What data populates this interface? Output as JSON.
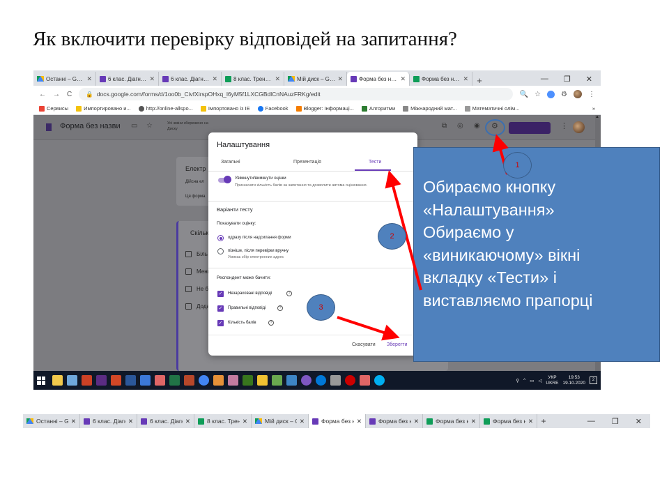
{
  "slide": {
    "title": "Як включити перевірку відповідей на запитання?"
  },
  "browser": {
    "tabs": [
      {
        "label": "Останні – Goog",
        "icon": "drive-icon"
      },
      {
        "label": "6 клас. Діагност",
        "icon": "forms-icon"
      },
      {
        "label": "6 клас. Діагност",
        "icon": "forms-icon"
      },
      {
        "label": "8 клас. Тренува",
        "icon": "sheets-icon"
      },
      {
        "label": "Мій диск – Goo",
        "icon": "drive-icon"
      },
      {
        "label": "Форма без назв",
        "icon": "forms-icon",
        "active": true
      },
      {
        "label": "Форма без назв",
        "icon": "sheets-icon"
      }
    ],
    "url": "docs.google.com/forms/d/1oo0b_CivfXirspOHxq_l6yM5f1LXCGBdlCnNAuzFRKg/edit",
    "bookmarks": [
      "Сервисы",
      "Импортировано и...",
      "http://online-allspo...",
      "Імпортовано із IE",
      "Facebook",
      "Blogger: Інформаці...",
      "Алгоритми",
      "Міжнародний мат...",
      "Математичні олім..."
    ],
    "bookmarks_more": "»"
  },
  "forms_page": {
    "form_name": "Форма без назви",
    "saved_note": "Усі зміни збережено на Диску",
    "bg_heading": "Електр",
    "bg_sub1": "Дійсна ел",
    "bg_sub2": "Ця форма",
    "bg_question": "Скільк",
    "bg_options": [
      "Біль",
      "Менш",
      "Не б",
      "Дода"
    ]
  },
  "dialog": {
    "title": "Налаштування",
    "tabs": [
      "Загальні",
      "Презентація",
      "Тести"
    ],
    "active_tab": "Тести",
    "toggle_label": "Увімкнути/вимкнути оцінки",
    "toggle_desc": "Призначати кількість балів за запитання та дозволити автома оцінювання.",
    "section_title": "Варіанти тесту",
    "show_score_label": "Показувати оцінку:",
    "radio_options": [
      {
        "label": "одразу після надсилання форми",
        "selected": true
      },
      {
        "label": "пізніше, після перевірки вручну",
        "selected": false,
        "sub": "Умикає збір електронних адрес"
      }
    ],
    "respondent_label": "Респондент може бачити:",
    "checkboxes": [
      "Незараховані відповіді",
      "Правильні відповіді",
      "Кількість балів"
    ],
    "cancel_label": "Скасувати",
    "save_label": "Зберегти"
  },
  "taskbar": {
    "lang": "УКР",
    "lang_sub": "UKRE",
    "time": "19:53",
    "date": "19.10.2020",
    "notifications": "2"
  },
  "callout": {
    "lines": [
      "Обираємо кнопку",
      "«Налаштування»",
      "Обираємо у",
      "«виникаючому» вікні",
      "вкладку «Тести» і",
      "виставляємо прапорці"
    ]
  },
  "markers": [
    "1",
    "2",
    "3"
  ],
  "colors": {
    "forms_purple": "#673ab7",
    "callout_blue": "#4f81bd",
    "arrow_red": "#ff0000"
  },
  "bottom_tabbar": {
    "tabs": [
      {
        "label": "Останні – Goog",
        "icon": "drive-icon"
      },
      {
        "label": "6 клас. Діагн",
        "icon": "forms-icon"
      },
      {
        "label": "6 клас. Діагн",
        "icon": "forms-icon"
      },
      {
        "label": "8 клас. Трен",
        "icon": "sheets-icon"
      },
      {
        "label": "Мій диск – G",
        "icon": "drive-icon"
      },
      {
        "label": "Форма без н",
        "icon": "forms-icon",
        "active": true
      },
      {
        "label": "Форма без н",
        "icon": "forms-icon"
      },
      {
        "label": "Форма без н",
        "icon": "sheets-icon"
      },
      {
        "label": "Форма без н",
        "icon": "sheets-icon"
      }
    ]
  }
}
